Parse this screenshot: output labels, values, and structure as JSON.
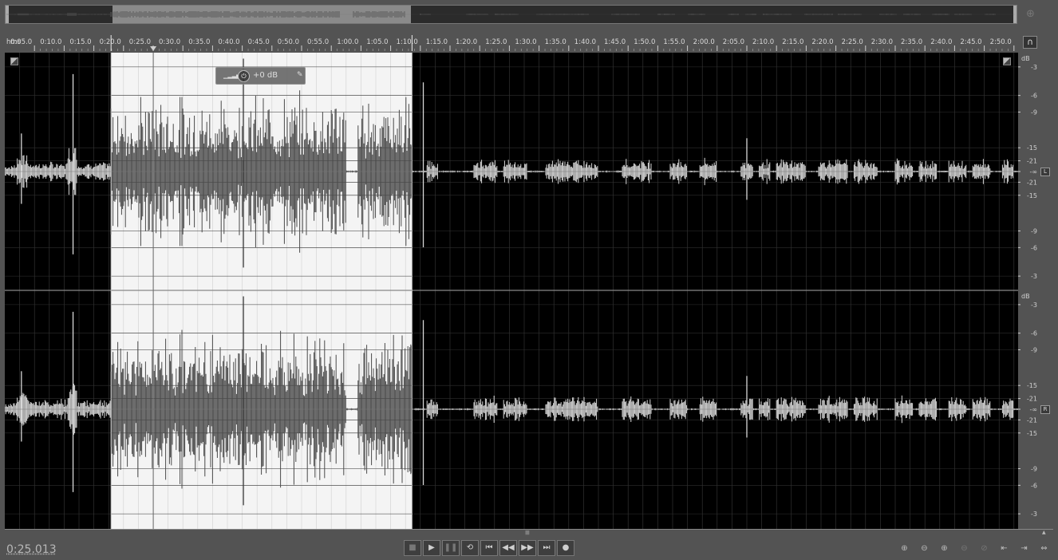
{
  "ruler": {
    "unit": "hms",
    "ticks": [
      "0:05.0",
      "0:10.0",
      "0:15.0",
      "0:20.0",
      "0:25.0",
      "0:30.0",
      "0:35.0",
      "0:40.0",
      "0:45.0",
      "0:50.0",
      "0:55.0",
      "1:00.0",
      "1:05.0",
      "1:10.0",
      "1:15.0",
      "1:20.0",
      "1:25.0",
      "1:30.0",
      "1:35.0",
      "1:40.0",
      "1:45.0",
      "1:50.0",
      "1:55.0",
      "2:00.0",
      "2:05.0",
      "2:10.0",
      "2:15.0",
      "2:20.0",
      "2:25.0",
      "2:30.0",
      "2:35.0",
      "2:40.0",
      "2:45.0",
      "2:50.0"
    ]
  },
  "selection": {
    "start_seconds": 17.9,
    "end_seconds": 68.6
  },
  "playhead_seconds": 25.013,
  "channels": [
    {
      "name": "left",
      "badge": "L",
      "unit": "dB",
      "scale_top": [
        "-3",
        "-6",
        "-9",
        "-15",
        "-21"
      ],
      "center": "-∞",
      "scale_bottom": [
        "-21",
        "-15",
        "-9",
        "-6",
        "-3"
      ]
    },
    {
      "name": "right",
      "badge": "R",
      "unit": "dB",
      "scale_top": [
        "-3",
        "-6",
        "-9",
        "-15",
        "-21"
      ],
      "center": "-∞",
      "scale_bottom": [
        "-21",
        "-15",
        "-9",
        "-6",
        "-3"
      ]
    }
  ],
  "hud": {
    "value": "+0 dB",
    "knob_icon": "power-knob-icon",
    "pin_icon": "pin-icon"
  },
  "time_display": "0:25.013",
  "transport": {
    "buttons": [
      {
        "name": "stop-button",
        "glyph": "■",
        "enabled": false
      },
      {
        "name": "play-button",
        "glyph": "▶",
        "enabled": true
      },
      {
        "name": "pause-button",
        "glyph": "❚❚",
        "enabled": false
      },
      {
        "name": "loop-button",
        "glyph": "⟲",
        "enabled": true
      },
      {
        "name": "go-to-start-button",
        "glyph": "⏮",
        "enabled": true
      },
      {
        "name": "rewind-button",
        "glyph": "◀◀",
        "enabled": true
      },
      {
        "name": "fast-forward-button",
        "glyph": "▶▶",
        "enabled": true
      },
      {
        "name": "go-to-end-button",
        "glyph": "⏭",
        "enabled": true
      },
      {
        "name": "record-button",
        "glyph": "●",
        "enabled": true
      }
    ]
  },
  "zoom_tools": [
    {
      "name": "zoom-in-amplitude-icon",
      "glyph": "⊕",
      "enabled": true
    },
    {
      "name": "zoom-out-amplitude-icon",
      "glyph": "⊖",
      "enabled": true
    },
    {
      "name": "zoom-in-time-icon",
      "glyph": "⊕",
      "enabled": true
    },
    {
      "name": "zoom-out-time-icon",
      "glyph": "⊖",
      "enabled": false
    },
    {
      "name": "zoom-out-full-icon",
      "glyph": "⊘",
      "enabled": false
    },
    {
      "name": "zoom-in-at-start-icon",
      "glyph": "⇤",
      "enabled": true
    },
    {
      "name": "zoom-in-at-end-icon",
      "glyph": "⇥",
      "enabled": true
    },
    {
      "name": "zoom-to-selection-icon",
      "glyph": "⇔",
      "enabled": true
    }
  ],
  "colors": {
    "waveform_unselected": "#d8d8d8",
    "waveform_selected": "#4a4a4a",
    "background_unselected": "#000000",
    "background_selected": "#f4f4f4",
    "grid": "#3a3a3a"
  }
}
